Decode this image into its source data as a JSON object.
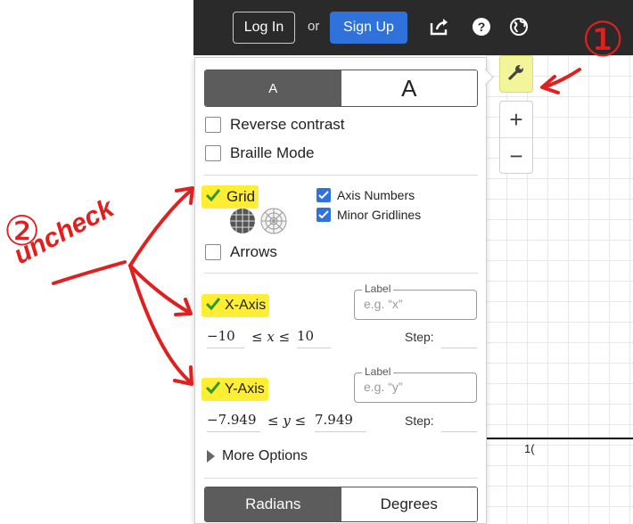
{
  "header": {
    "login_label": "Log In",
    "or_label": "or",
    "signup_label": "Sign Up",
    "icons": [
      "share-icon",
      "help-icon",
      "globe-icon"
    ]
  },
  "graph": {
    "tick_label": "1("
  },
  "controls": {
    "wrench_icon": "wrench-icon",
    "zoom_in": "+",
    "zoom_out": "−"
  },
  "settings": {
    "font_size": {
      "small": "A",
      "large": "A"
    },
    "reverse_contrast": {
      "label": "Reverse contrast",
      "checked": false
    },
    "braille_mode": {
      "label": "Braille Mode",
      "checked": false
    },
    "grid": {
      "label": "Grid",
      "checked": true
    },
    "axis_numbers": {
      "label": "Axis Numbers",
      "checked": true
    },
    "minor_gridlines": {
      "label": "Minor Gridlines",
      "checked": true
    },
    "arrows": {
      "label": "Arrows",
      "checked": false
    },
    "x_axis": {
      "label": "X-Axis",
      "checked": true,
      "label_legend": "Label",
      "label_placeholder": "e.g. “x”",
      "min": "−10",
      "relation": "≤ 𝑥 ≤",
      "max": "10",
      "step_label": "Step:"
    },
    "y_axis": {
      "label": "Y-Axis",
      "checked": true,
      "label_legend": "Label",
      "label_placeholder": "e.g. “y”",
      "min": "−7.949",
      "relation": "≤ 𝑦 ≤",
      "max": "7.949",
      "step_label": "Step:"
    },
    "more_options": "More Options",
    "angle_mode": {
      "radians": "Radians",
      "degrees": "Degrees",
      "selected": "Radians"
    }
  },
  "annotations": {
    "marker_1": "①",
    "marker_2": "②",
    "note": "uncheck"
  },
  "colors": {
    "highlight": "#ffee33",
    "annotation_red": "#e02020",
    "accent_blue": "#2f72dc"
  }
}
